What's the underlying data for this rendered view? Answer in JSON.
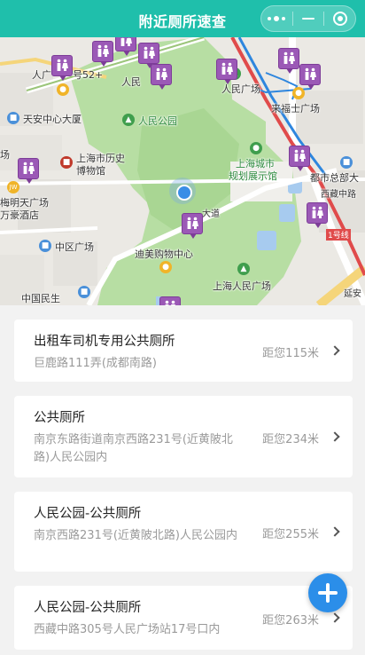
{
  "header": {
    "title": "附近厕所速查"
  },
  "map": {
    "labels": {
      "l1": "人广",
      "l2": "号52+",
      "l3": "人民",
      "l4": "人民广场",
      "l5": "天安中心大厦",
      "l6": "人民公园",
      "l7": "来福士广场",
      "l8": "场",
      "l9": "上海市历史",
      "l10": "博物馆",
      "l11": "上海城市",
      "l12": "规划展示馆",
      "l13": "都市总部大",
      "l14": "梅明天广场",
      "l15": "万豪酒店",
      "l16": "中区广场",
      "l17": "迪美购物中心",
      "l18": "上海人民广场",
      "l19": "中国民生",
      "l20": "西藏中路",
      "l21": "大道",
      "l22": "1号线",
      "l23": "延安"
    }
  },
  "toilets": [
    {
      "name": "出租车司机专用公共厕所",
      "address": "巨鹿路111弄(成都南路)",
      "distance": "距您115米"
    },
    {
      "name": "公共厕所",
      "address": "南京东路街道南京西路231号(近黄陂北路)人民公园内",
      "distance": "距您234米"
    },
    {
      "name": "人民公园-公共厕所",
      "address": "南京西路231号(近黄陂北路)人民公园内",
      "distance": "距您255米"
    },
    {
      "name": "人民公园-公共厕所",
      "address": "西藏中路305号人民广场站17号口内",
      "distance": "距您263米"
    }
  ]
}
